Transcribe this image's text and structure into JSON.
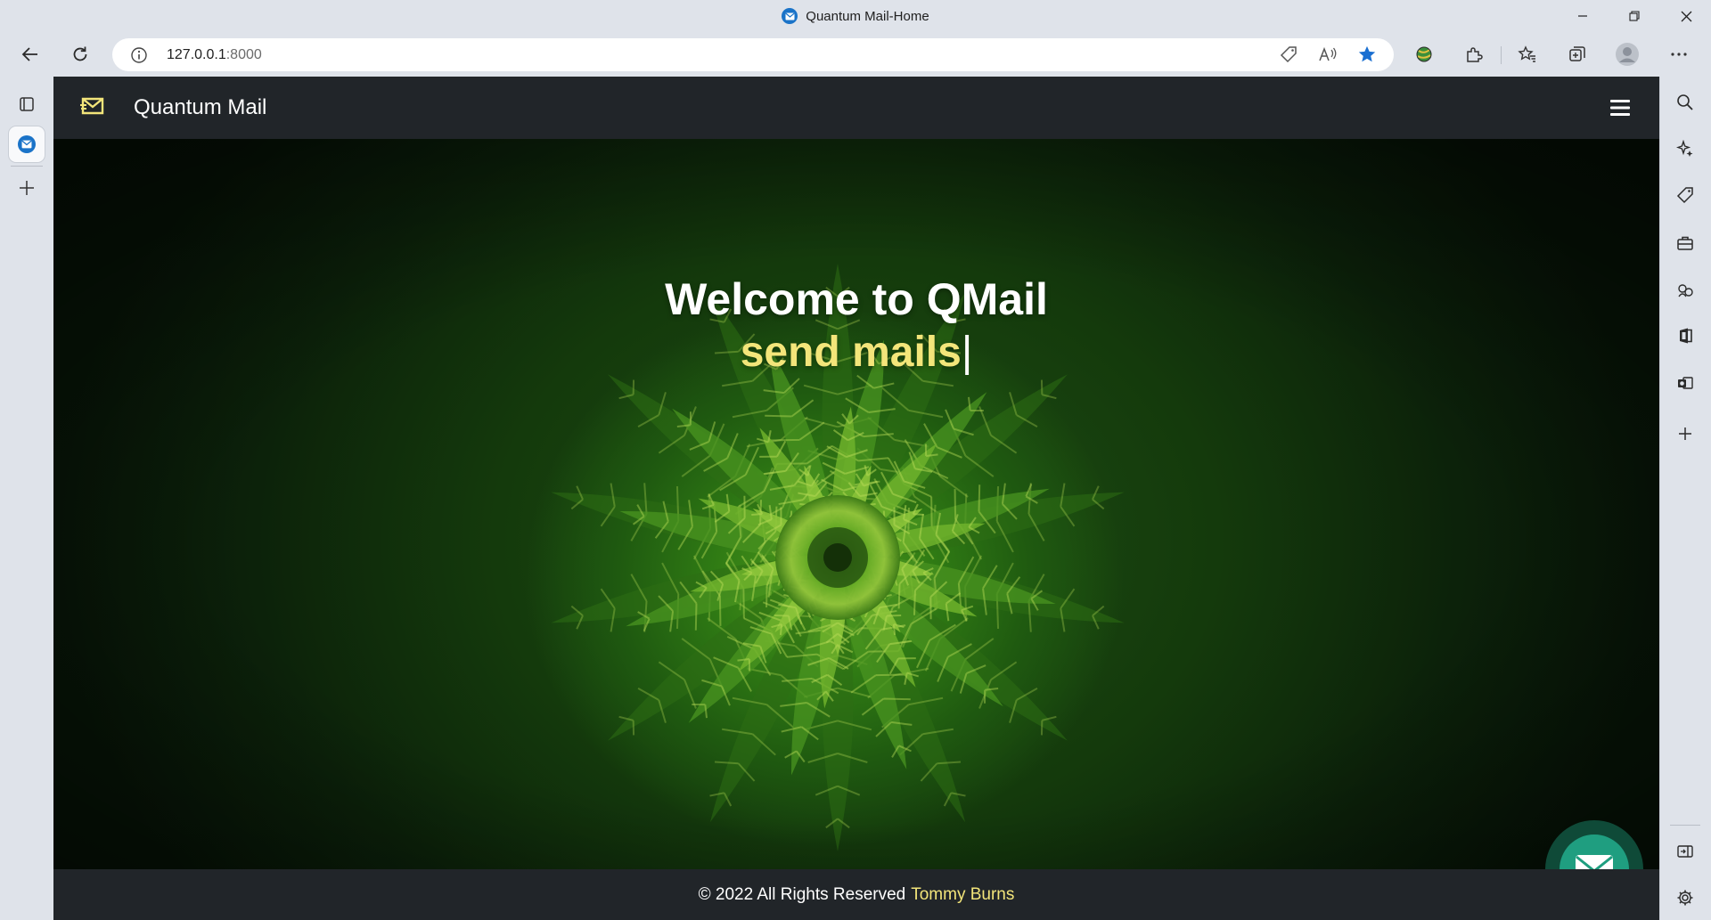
{
  "browser": {
    "tab_title": "Quantum Mail-Home",
    "url_host": "127.0.0.1",
    "url_port": ":8000"
  },
  "page": {
    "brand_name": "Quantum Mail",
    "hero_title": "Welcome to QMail",
    "hero_subtitle": "send mails",
    "hero_cursor": "|",
    "footer_text": "© 2022 All Rights Reserved",
    "footer_author": "Tommy Burns"
  },
  "colors": {
    "navbar": "#212529",
    "accent_yellow": "#f3e57a",
    "fab": "#1f9e80"
  }
}
